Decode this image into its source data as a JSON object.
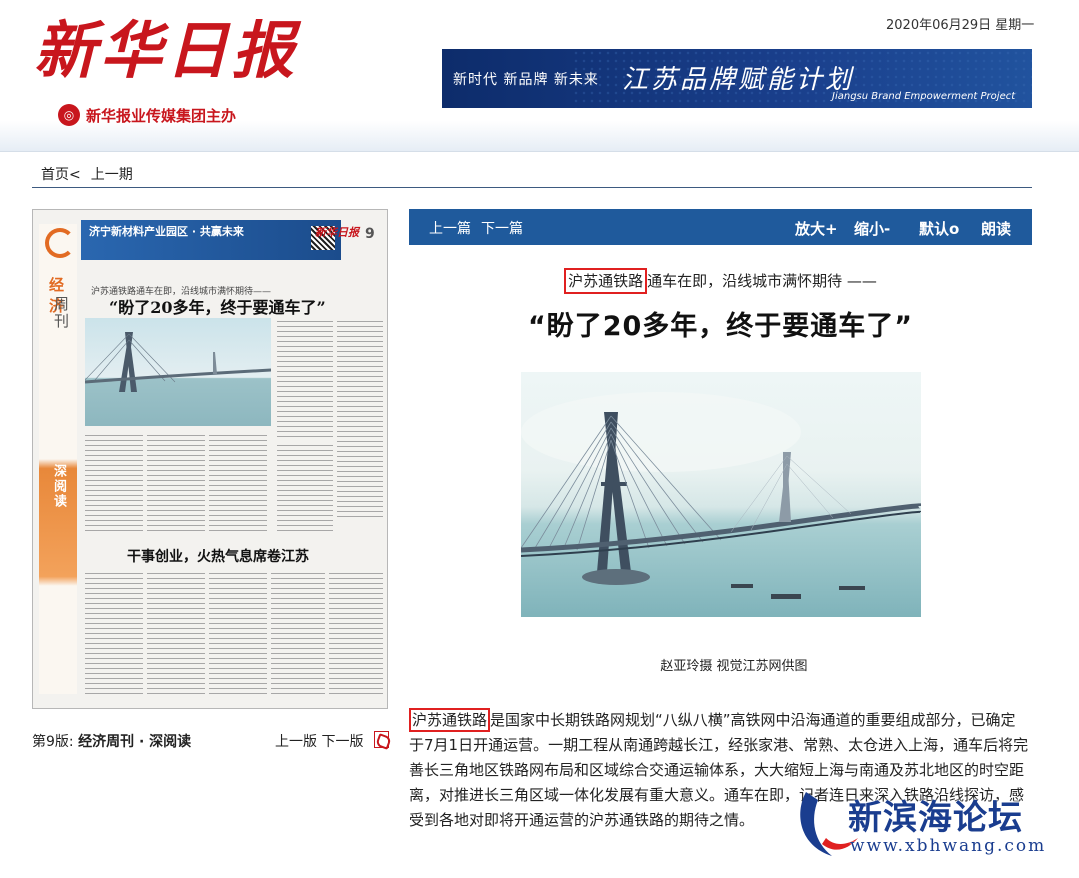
{
  "header": {
    "masthead": "新华日报",
    "publisher": "新华报业传媒集团主办",
    "date": "2020年06月29日  星期一",
    "banner": {
      "slogan": "新时代  新品牌  新未来",
      "title": "江苏品牌赋能计划",
      "english": "Jiangsu Brand Empowerment Project"
    }
  },
  "breadcrumb": {
    "home": "首页<",
    "prev_issue": "上一期"
  },
  "page_thumb": {
    "ad_title": "济宁新材料产业园区 · 共赢未来",
    "logo": "新华日报",
    "page_number": "9",
    "side_title": "经济",
    "side_subtitle": "周刊",
    "side_column": "深阅读",
    "kicker": "沪苏通铁路通车在即，沿线城市满怀期待——",
    "headline": "“盼了20多年，终于要通车了”",
    "headline_2": "干事创业，火热气息席卷江苏"
  },
  "edition": {
    "prefix": "第9版:",
    "name": "经济周刊 · 深阅读",
    "prev": "上一版",
    "next": "下一版"
  },
  "toolbar": {
    "prev_article": "上一篇",
    "next_article": "下一篇",
    "zoom_in": "放大+",
    "zoom_out": "缩小-",
    "default": "默认o",
    "read_aloud": "朗读"
  },
  "article": {
    "subtitle_highlight": "沪苏通铁路",
    "subtitle_rest": "通车在即，沿线城市满怀期待 ——",
    "title": "“盼了20多年，终于要通车了”",
    "caption": "赵亚玲摄  视觉江苏网供图",
    "body_highlight": "沪苏通铁路",
    "body_rest": "是国家中长期铁路网规划“八纵八横”高铁网中沿海通道的重要组成部分，已确定于7月1日开通运营。一期工程从南通跨越长江，经张家港、常熟、太仓进入上海，通车后将完善长三角地区铁路网布局和区域综合交通运输体系，大大缩短上海与南通及苏北地区的时空距离，对推进长三角区域一体化发展有重大意义。通车在即，记者连日来深入铁路沿线探访，感受到各地对即将开通运营的沪苏通铁路的期待之情。"
  },
  "watermark": {
    "title": "新滨海论坛",
    "url": "www.xbhwang.com"
  },
  "colors": {
    "brand_red": "#c8161d",
    "toolbar_blue": "#1f5a9c",
    "highlight_box": "#e02020",
    "watermark_blue": "#1a3d8f"
  }
}
